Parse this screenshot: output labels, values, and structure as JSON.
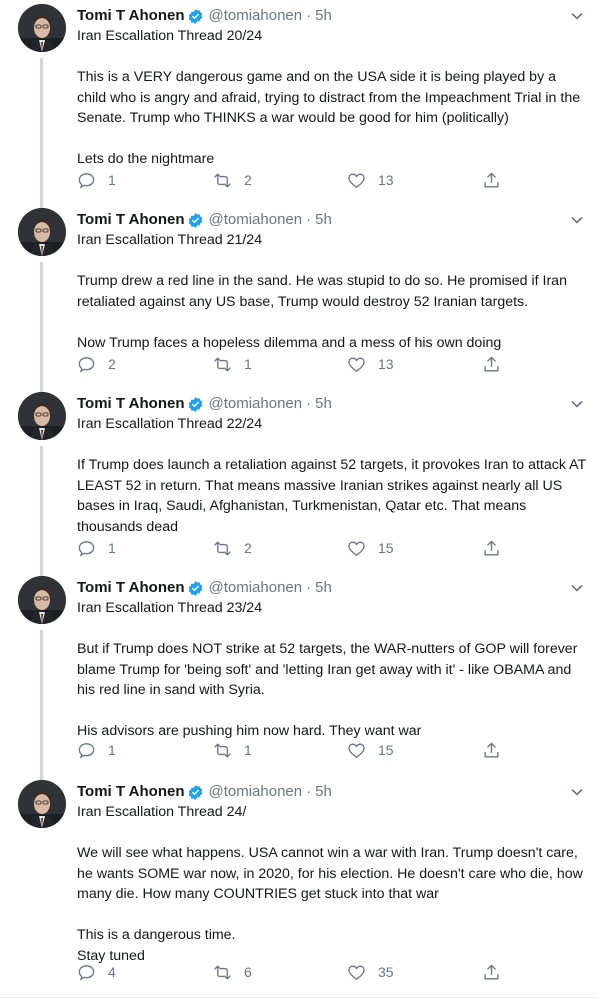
{
  "colors": {
    "accent": "#1da1f2",
    "muted": "#657786",
    "text": "#14171a",
    "thread_line": "#ccd6dd"
  },
  "tweets": [
    {
      "name": "Tomi T Ahonen",
      "handle": "@tomiahonen",
      "separator": "·",
      "time": "5h",
      "verified": true,
      "text": "Iran Escallation Thread 20/24\n\nThis is a VERY dangerous game and on the USA side it is being played by a child who is angry and afraid, trying to distract from the Impeachment Trial in the Senate. Trump who THINKS a war would be good for him (politically)\n\nLets do the nightmare",
      "replies": "1",
      "retweets": "2",
      "likes": "13"
    },
    {
      "name": "Tomi T Ahonen",
      "handle": "@tomiahonen",
      "separator": "·",
      "time": "5h",
      "verified": true,
      "text": "Iran Escallation Thread 21/24\n\nTrump drew a red line in the sand. He was stupid to do so. He promised if Iran retaliated against any US base, Trump would destroy 52 Iranian targets.\n\nNow Trump faces a hopeless dilemma and a mess of his own doing",
      "replies": "2",
      "retweets": "1",
      "likes": "13"
    },
    {
      "name": "Tomi T Ahonen",
      "handle": "@tomiahonen",
      "separator": "·",
      "time": "5h",
      "verified": true,
      "text": "Iran Escallation Thread 22/24\n\nIf Trump does launch a retaliation against 52 targets, it provokes Iran to attack AT LEAST 52 in return. That means massive Iranian strikes against nearly all US bases in Iraq, Saudi, Afghanistan, Turkmenistan, Qatar etc. That means thousands dead",
      "replies": "1",
      "retweets": "2",
      "likes": "15"
    },
    {
      "name": "Tomi T Ahonen",
      "handle": "@tomiahonen",
      "separator": "·",
      "time": "5h",
      "verified": true,
      "text": "Iran Escallation Thread 23/24\n\nBut if Trump does NOT strike at 52 targets, the WAR-nutters of GOP will forever blame Trump for 'being soft' and 'letting Iran get away with it' - like OBAMA and his red line in sand with Syria.\n\nHis advisors are pushing him now hard. They want war",
      "replies": "1",
      "retweets": "1",
      "likes": "15"
    },
    {
      "name": "Tomi T Ahonen",
      "handle": "@tomiahonen",
      "separator": "·",
      "time": "5h",
      "verified": true,
      "text": "Iran Escallation Thread 24/\n\nWe will see what happens. USA cannot win a war with Iran. Trump doesn't care, he wants SOME war now, in 2020, for his election. He doesn't care who die, how many die. How many COUNTRIES get stuck into that war\n\nThis is a dangerous time.\nStay tuned",
      "replies": "4",
      "retweets": "6",
      "likes": "35"
    }
  ]
}
